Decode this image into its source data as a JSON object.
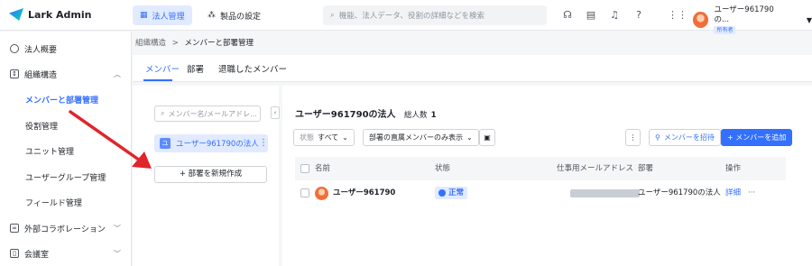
{
  "app": {
    "title": "Lark Admin"
  },
  "topnav": [
    {
      "label": "法人管理",
      "icon": "building-icon",
      "active": true
    },
    {
      "label": "製品の設定",
      "icon": "grid-gear-icon",
      "active": false
    }
  ],
  "search": {
    "placeholder": "機能、法人データ、役割の詳細などを検索"
  },
  "user": {
    "name": "ユーザー961790の...",
    "badge": "所有者"
  },
  "sidebar": {
    "items": [
      {
        "label": "法人概要",
        "icon": "gear-icon"
      },
      {
        "label": "組織構造",
        "icon": "org-icon"
      },
      {
        "label": "メンバーと部署管理",
        "active": true
      },
      {
        "label": "役割管理"
      },
      {
        "label": "ユニット管理"
      },
      {
        "label": "ユーザーグループ管理"
      },
      {
        "label": "フィールド管理"
      },
      {
        "label": "外部コラボレーション",
        "icon": "link-icon"
      },
      {
        "label": "会議室",
        "icon": "door-icon"
      }
    ]
  },
  "breadcrumb": {
    "parent": "組織構造",
    "sep": ">",
    "current": "メンバーと部署管理"
  },
  "tabs": [
    "メンバー",
    "部署",
    "退職したメンバー"
  ],
  "dept_panel": {
    "search_placeholder": "メンバー名/メールアドレ...",
    "org_badge": "ユ",
    "org_name": "ユーザー961790の法人",
    "new_dept": "+ 部署を新規作成"
  },
  "org": {
    "title": "ユーザー961790の法人",
    "count_label": "総人数",
    "count": "1"
  },
  "filters": {
    "status_label": "状態",
    "status_value": "すべて",
    "scope": "部署の直属メンバーのみ表示"
  },
  "actions": {
    "invite": "メンバーを招待",
    "add": "+ メンバーを追加"
  },
  "table": {
    "headers": [
      "名前",
      "状態",
      "仕事用メールアドレス",
      "部署",
      "操作"
    ],
    "rows": [
      {
        "name": "ユーザー961790",
        "status": "正常",
        "dept": "ユーザー961790の法人",
        "detail": "詳細",
        "more": "···"
      }
    ]
  },
  "colors": {
    "accent": "#3370ff",
    "annotation_arrow": "#e0242b"
  }
}
